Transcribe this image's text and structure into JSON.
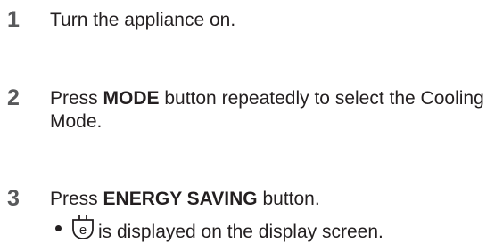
{
  "steps": [
    {
      "number": "1",
      "text_before": "Turn the appliance on.",
      "bold": "",
      "text_after": ""
    },
    {
      "number": "2",
      "text_before": "Press ",
      "bold": "MODE",
      "text_after": " button repeatedly to select the Cooling Mode."
    },
    {
      "number": "3",
      "text_before": "Press ",
      "bold": "ENERGY SAVING",
      "text_after": " button."
    }
  ],
  "bullet": {
    "icon": "energy-saving-plug-icon",
    "text": "is displayed on the display screen."
  },
  "colors": {
    "text": "#231f20",
    "step_number": "#58595b"
  }
}
